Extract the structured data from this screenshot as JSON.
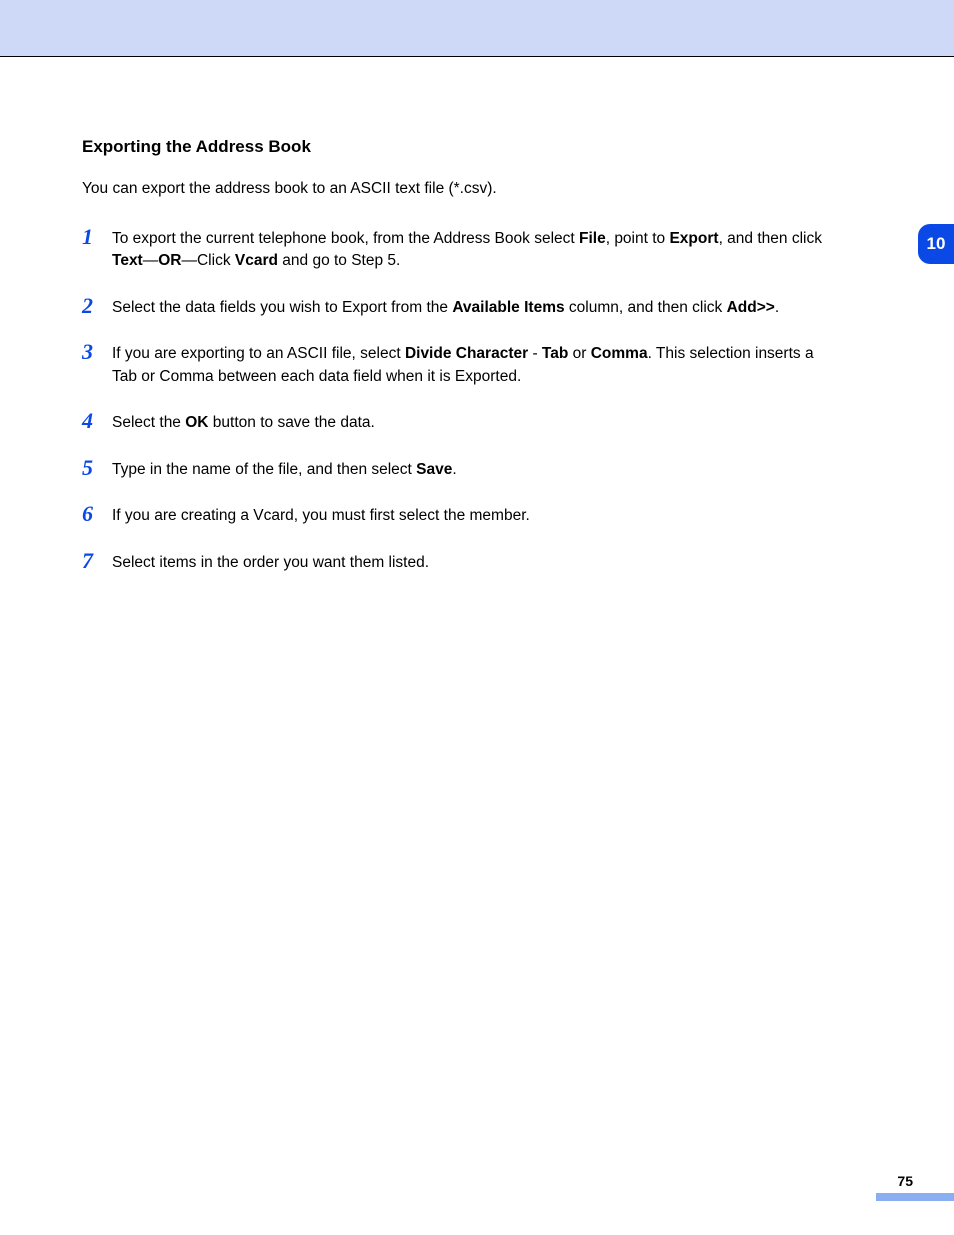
{
  "section_number": "10",
  "page_number": "75",
  "heading": "Exporting the Address Book",
  "intro": "You can export the address book to an ASCII text file (*.csv).",
  "steps": [
    {
      "num": "1",
      "segments": [
        {
          "t": "To export the current telephone book, from the Address Book select "
        },
        {
          "t": "File",
          "b": true
        },
        {
          "t": ", point to "
        },
        {
          "t": "Export",
          "b": true
        },
        {
          "t": ", and then click "
        },
        {
          "t": "Text",
          "b": true
        },
        {
          "t": "—"
        },
        {
          "t": "OR",
          "b": true
        },
        {
          "t": "—Click "
        },
        {
          "t": "Vcard",
          "b": true
        },
        {
          "t": " and go to Step 5."
        }
      ]
    },
    {
      "num": "2",
      "segments": [
        {
          "t": "Select the data fields you wish to Export from the "
        },
        {
          "t": "Available Items",
          "b": true
        },
        {
          "t": " column, and then click "
        },
        {
          "t": "Add>>",
          "b": true
        },
        {
          "t": "."
        }
      ]
    },
    {
      "num": "3",
      "segments": [
        {
          "t": "If you are exporting to an ASCII file, select "
        },
        {
          "t": "Divide Character",
          "b": true
        },
        {
          "t": " - "
        },
        {
          "t": "Tab",
          "b": true
        },
        {
          "t": " or "
        },
        {
          "t": "Comma",
          "b": true
        },
        {
          "t": ". This selection inserts a Tab or Comma between each data field when it is Exported."
        }
      ]
    },
    {
      "num": "4",
      "segments": [
        {
          "t": "Select the "
        },
        {
          "t": "OK",
          "b": true
        },
        {
          "t": " button to save the data."
        }
      ]
    },
    {
      "num": "5",
      "segments": [
        {
          "t": "Type in the name of the file, and then select "
        },
        {
          "t": "Save",
          "b": true
        },
        {
          "t": "."
        }
      ]
    },
    {
      "num": "6",
      "segments": [
        {
          "t": "If you are creating a Vcard, you must first select the member."
        }
      ]
    },
    {
      "num": "7",
      "segments": [
        {
          "t": "Select items in the order you want them listed."
        }
      ]
    }
  ]
}
